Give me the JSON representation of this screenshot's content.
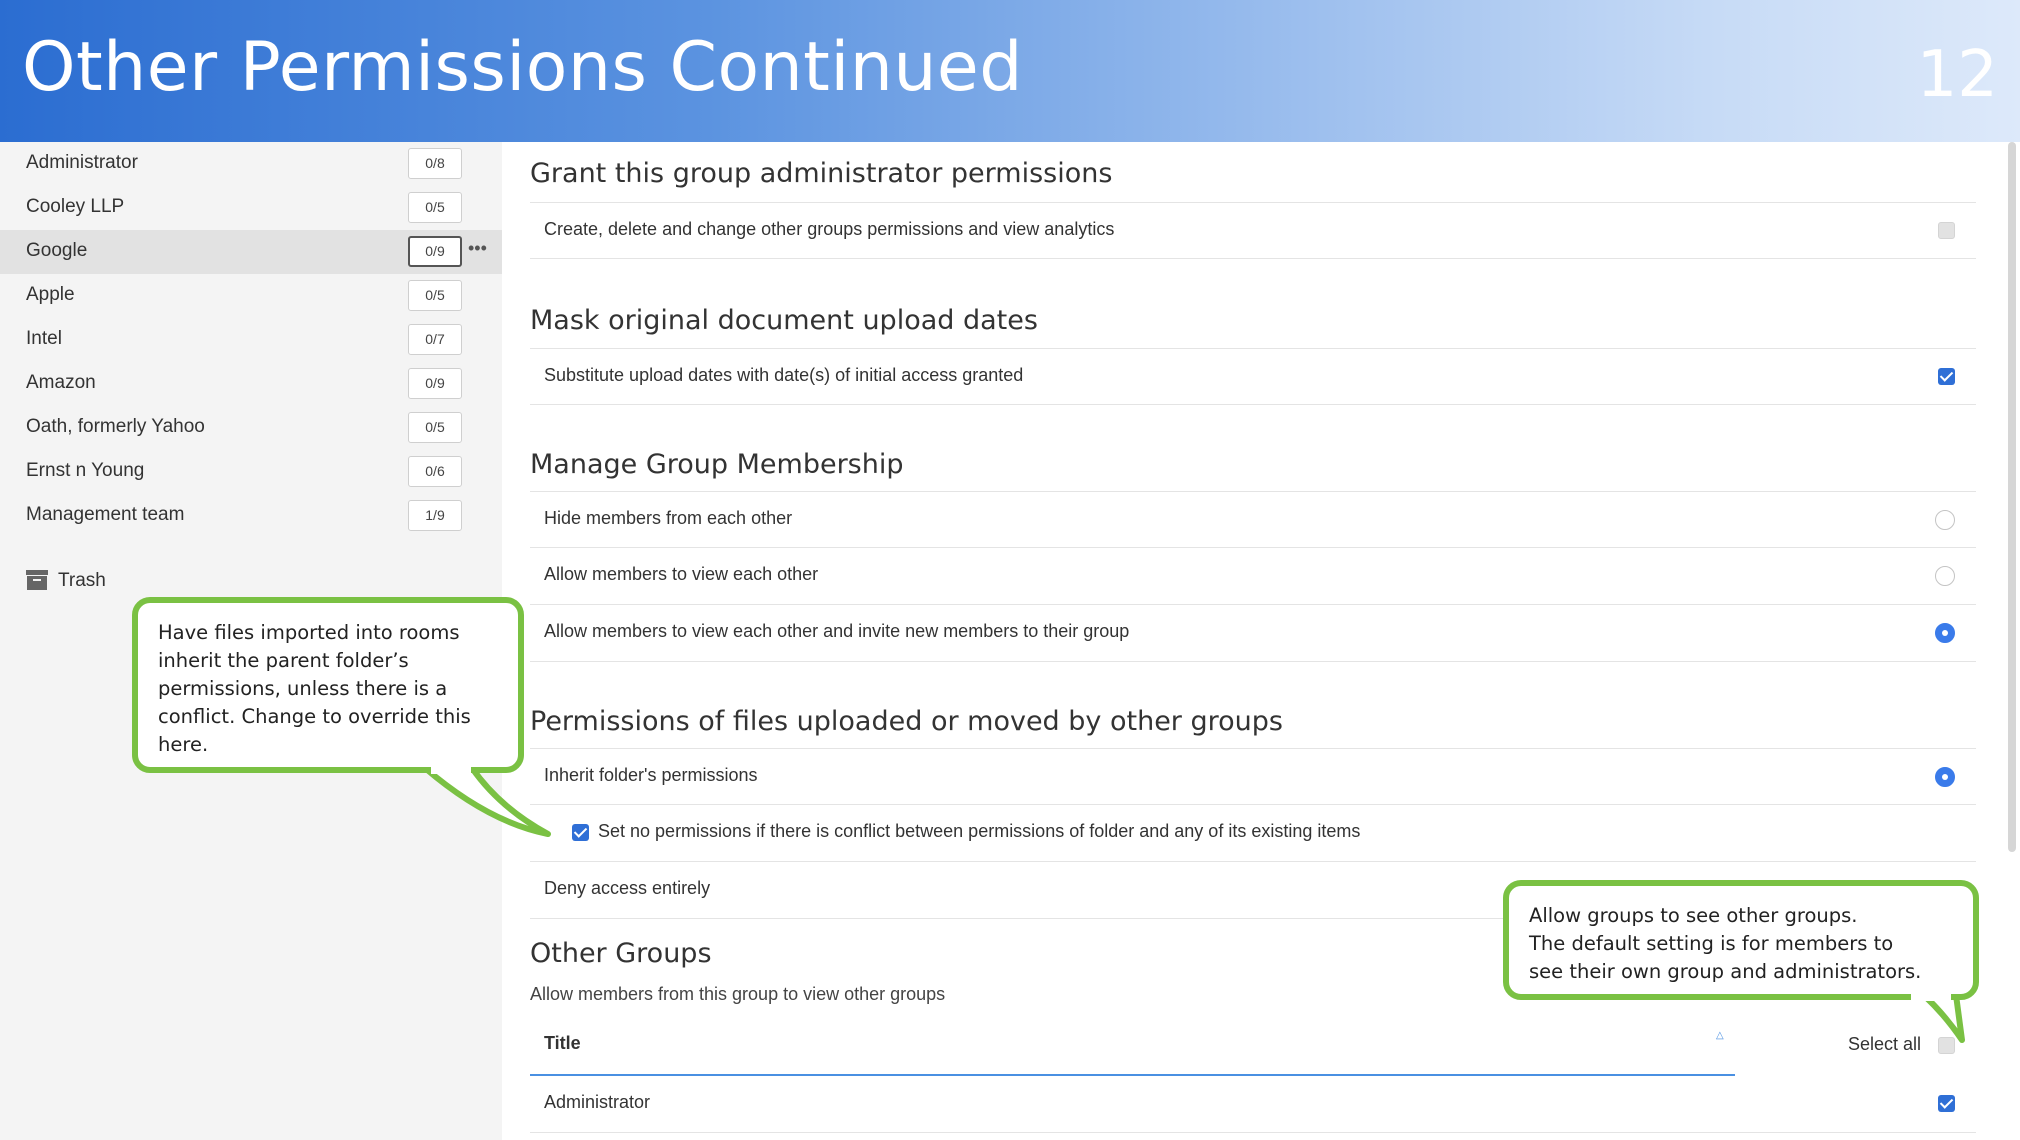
{
  "slide": {
    "title": "Other Permissions Continued",
    "page_number": "12"
  },
  "sidebar": {
    "groups": [
      {
        "name": "Administrator",
        "count": "0/8"
      },
      {
        "name": "Cooley LLP",
        "count": "0/5"
      },
      {
        "name": "Google",
        "count": "0/9",
        "selected": true
      },
      {
        "name": "Apple",
        "count": "0/5"
      },
      {
        "name": "Intel",
        "count": "0/7"
      },
      {
        "name": "Amazon",
        "count": "0/9"
      },
      {
        "name": "Oath, formerly Yahoo",
        "count": "0/5"
      },
      {
        "name": "Ernst n Young",
        "count": "0/6"
      },
      {
        "name": "Management team",
        "count": "1/9"
      }
    ],
    "more_icon": "•••",
    "trash_label": "Trash"
  },
  "sections": {
    "admin": {
      "title": "Grant this group administrator permissions",
      "option": "Create, delete and change other groups permissions and view analytics",
      "checked": false
    },
    "mask": {
      "title": "Mask original document upload dates",
      "option": "Substitute upload dates with date(s) of initial access granted",
      "checked": true
    },
    "membership": {
      "title": "Manage Group Membership",
      "options": [
        {
          "label": "Hide members from each other",
          "selected": false
        },
        {
          "label": "Allow members to view each other",
          "selected": false
        },
        {
          "label": "Allow members to view each other and invite new members to their group",
          "selected": true
        }
      ]
    },
    "file_permissions": {
      "title": "Permissions of files uploaded or moved by other groups",
      "inherit_label": "Inherit folder's permissions",
      "inherit_selected": true,
      "conflict_label": "Set no permissions if there is conflict between permissions of folder and any of its existing items",
      "conflict_checked": true,
      "deny_label": "Deny access entirely"
    },
    "other_groups": {
      "title": "Other Groups",
      "subtitle": "Allow members from this group to view other groups",
      "column_title": "Title",
      "select_all_label": "Select all",
      "rows": [
        {
          "name": "Administrator",
          "checked": true
        }
      ]
    }
  },
  "callouts": {
    "left": "Have files imported into rooms inherit the parent folder’s permissions, unless there is a conflict. Change to override this here.",
    "right_lines": [
      "Allow groups to see other groups.",
      "The default setting is for members to",
      "see their own group and administrators."
    ]
  },
  "colors": {
    "callout_border": "#7ac143",
    "accent_blue": "#2f6fd6",
    "banner_start": "#2b6dd1",
    "banner_end": "#dde9fa"
  }
}
